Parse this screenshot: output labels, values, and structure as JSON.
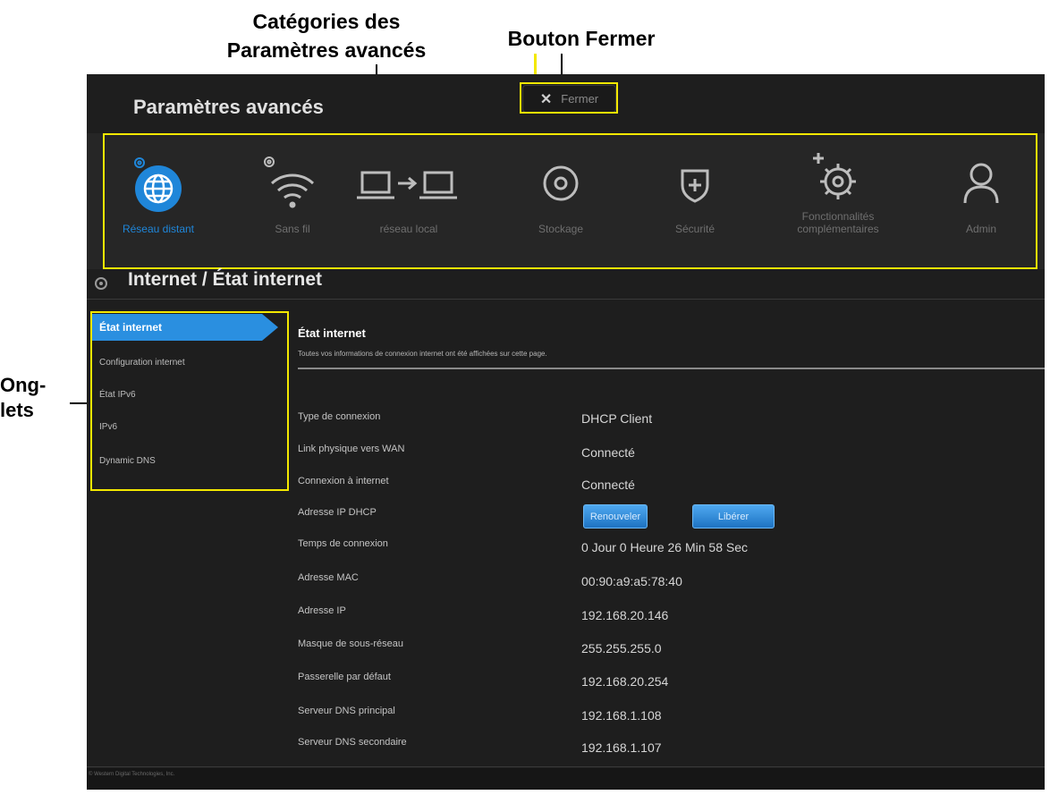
{
  "annotations": {
    "categories_line1": "Catégories des",
    "categories_line2": "Paramètres avancés",
    "close_button": "Bouton Fermer",
    "tabs_line1": "Ong-",
    "tabs_line2": "lets",
    "highlight_color": "#f3e800"
  },
  "header": {
    "title": "Paramètres avancés",
    "close_label": "Fermer"
  },
  "categories": [
    {
      "label": "Réseau distant",
      "icon": "globe-icon",
      "active": true
    },
    {
      "label": "Sans fil",
      "icon": "wifi-icon",
      "active": false
    },
    {
      "label": "réseau local",
      "icon": "lan-icon",
      "active": false
    },
    {
      "label": "Stockage",
      "icon": "storage-icon",
      "active": false
    },
    {
      "label": "Sécurité",
      "icon": "shield-icon",
      "active": false
    },
    {
      "label_line1": "Fonctionnalités",
      "label_line2": "complémentaires",
      "icon": "gear-plus-icon",
      "active": false
    },
    {
      "label": "Admin",
      "icon": "user-icon",
      "active": false
    }
  ],
  "section": {
    "title": "Internet / État internet"
  },
  "tabs": [
    {
      "label": "État internet",
      "active": true
    },
    {
      "label": "Configuration internet",
      "active": false
    },
    {
      "label": "État IPv6",
      "active": false
    },
    {
      "label": "IPv6",
      "active": false
    },
    {
      "label": "Dynamic DNS",
      "active": false
    }
  ],
  "content": {
    "title": "État internet",
    "description": "Toutes vos informations de connexion internet ont été affichées sur cette page.",
    "rows": [
      {
        "label": "Type de connexion",
        "value": "DHCP Client"
      },
      {
        "label": "Link physique vers WAN",
        "value": "Connecté"
      },
      {
        "label": "Connexion à internet",
        "value": "Connecté"
      },
      {
        "label": "Adresse IP DHCP",
        "value": ""
      },
      {
        "label": "Temps de connexion",
        "value": "0 Jour 0 Heure 26 Min 58 Sec"
      },
      {
        "label": "Adresse MAC",
        "value": "00:90:a9:a5:78:40"
      },
      {
        "label": "Adresse IP",
        "value": "192.168.20.146"
      },
      {
        "label": "Masque de sous-réseau",
        "value": "255.255.255.0"
      },
      {
        "label": "Passerelle par défaut",
        "value": "192.168.20.254"
      },
      {
        "label": "Serveur DNS principal",
        "value": "192.168.1.108"
      },
      {
        "label": "Serveur DNS secondaire",
        "value": "192.168.1.107"
      }
    ],
    "renew_label": "Renouveler",
    "release_label": "Libérer"
  },
  "footer": {
    "copyright": "© Western Digital Technologies, Inc."
  },
  "colors": {
    "accent": "#2a8fe0",
    "background": "#1e1e1e"
  }
}
